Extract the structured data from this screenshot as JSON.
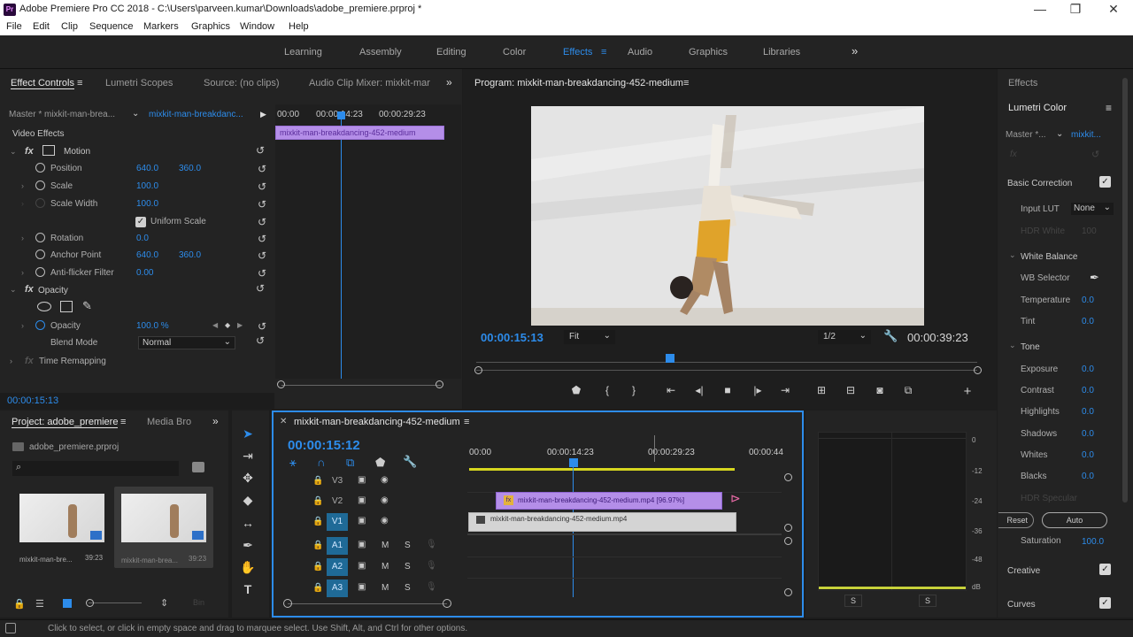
{
  "window": {
    "title": "Adobe Premiere Pro CC 2018 - C:\\Users\\parveen.kumar\\Downloads\\adobe_premiere.prproj *",
    "logo": "Pr",
    "controls": [
      "—",
      "❐",
      "✕"
    ]
  },
  "menu": [
    "File",
    "Edit",
    "Clip",
    "Sequence",
    "Markers",
    "Graphics",
    "Window",
    "Help"
  ],
  "workspaces": {
    "items": [
      "Learning",
      "Assembly",
      "Editing",
      "Color",
      "Effects",
      "Audio",
      "Graphics",
      "Libraries"
    ],
    "active": "Effects",
    "more": "»"
  },
  "effect_controls": {
    "tabs": [
      "Effect Controls",
      "Lumetri Scopes",
      "Source: (no clips)",
      "Audio Clip Mixer: mixkit-mar"
    ],
    "master": "Master * mixkit-man-brea...",
    "clip": "mixkit-man-breakdanc...",
    "mini_ruler": [
      "00:00",
      "00:00:14:23",
      "00:00:29:23"
    ],
    "mini_clip": "mixkit-man-breakdancing-452-medium",
    "video_effects": "Video Effects",
    "motion": "Motion",
    "rows": [
      {
        "label": "Position",
        "v1": "640.0",
        "v2": "360.0"
      },
      {
        "label": "Scale",
        "v1": "100.0",
        "v2": ""
      },
      {
        "label": "Scale Width",
        "v1": "100.0",
        "v2": ""
      },
      {
        "label": "Uniform Scale",
        "v1": "",
        "v2": ""
      },
      {
        "label": "Rotation",
        "v1": "0.0",
        "v2": ""
      },
      {
        "label": "Anchor Point",
        "v1": "640.0",
        "v2": "360.0"
      },
      {
        "label": "Anti-flicker Filter",
        "v1": "0.00",
        "v2": ""
      }
    ],
    "opacity_group": "Opacity",
    "opacity_label": "Opacity",
    "opacity_value": "100.0 %",
    "blend_label": "Blend Mode",
    "blend_value": "Normal",
    "time_remap": "Time Remapping",
    "timecode": "00:00:15:13"
  },
  "program": {
    "title": "Program: mixkit-man-breakdancing-452-medium",
    "timecode": "00:00:15:13",
    "fit": "Fit",
    "resolution": "1/2",
    "duration": "00:00:39:23",
    "playhead_fraction": 0.39
  },
  "right_panel": {
    "effects_tab": "Effects",
    "lumetri_title": "Lumetri Color",
    "master": "Master *...",
    "clip": "mixkit...",
    "basic_correction": "Basic Correction",
    "input_lut_label": "Input LUT",
    "input_lut_value": "None",
    "hdr_white": "HDR White",
    "hdr_white_value": "100",
    "white_balance": "White Balance",
    "wb_selector": "WB Selector",
    "temperature": {
      "label": "Temperature",
      "value": "0.0"
    },
    "tint": {
      "label": "Tint",
      "value": "0.0"
    },
    "tone": "Tone",
    "tone_rows": [
      {
        "label": "Exposure",
        "value": "0.0"
      },
      {
        "label": "Contrast",
        "value": "0.0"
      },
      {
        "label": "Highlights",
        "value": "0.0"
      },
      {
        "label": "Shadows",
        "value": "0.0"
      },
      {
        "label": "Whites",
        "value": "0.0"
      },
      {
        "label": "Blacks",
        "value": "0.0"
      }
    ],
    "hdr_specular": "HDR Specular",
    "reset_btn": "Reset",
    "auto_btn": "Auto",
    "saturation": {
      "label": "Saturation",
      "value": "100.0"
    },
    "creative": "Creative",
    "curves": "Curves"
  },
  "project": {
    "tabs": [
      "Project: adobe_premiere",
      "Media Bro"
    ],
    "file": "adobe_premiere.prproj",
    "items": [
      {
        "name": "mixkit-man-bre...",
        "duration": "39:23"
      },
      {
        "name": "mixkit-man-brea...",
        "duration": "39:23"
      }
    ]
  },
  "timeline": {
    "title": "mixkit-man-breakdancing-452-medium",
    "timecode": "00:00:15:12",
    "ruler": [
      "00:00",
      "00:00:14:23",
      "00:00:29:23",
      "00:00:44"
    ],
    "video_tracks": [
      "V3",
      "V2",
      "V1"
    ],
    "audio_tracks": [
      "A1",
      "A2",
      "A3"
    ],
    "clip_v2": "mixkit-man-breakdancing-452-medium.mp4 [96.97%]",
    "clip_v1": "mixkit-man-breakdancing-452-medium.mp4"
  },
  "meters": {
    "scale": [
      "0",
      "-12",
      "-24",
      "-36",
      "-48",
      "dB"
    ],
    "solo": [
      "S",
      "S"
    ]
  },
  "status": "Click to select, or click in empty space and drag to marquee select. Use Shift, Alt, and Ctrl for other options.",
  "colors": {
    "accent": "#2d8ceb",
    "clip_purple": "#b48ee8",
    "clip_grey": "#d4d4d4",
    "track_active": "#1f6a97",
    "playhead": "#2d8ceb"
  }
}
